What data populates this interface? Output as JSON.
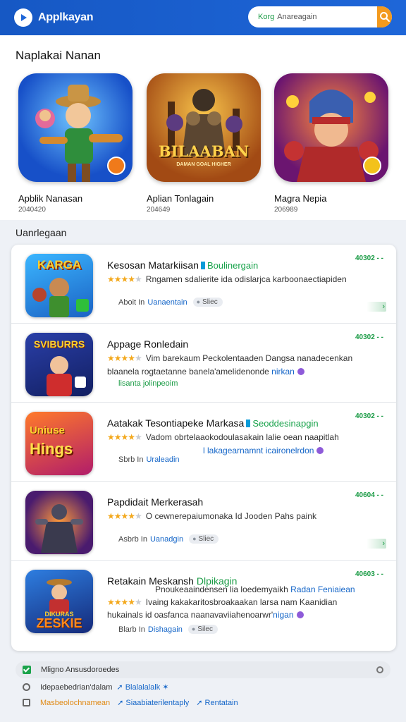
{
  "header": {
    "app_name": "Applkayan",
    "search_prefix": "Korg",
    "search_placeholder": "Anareagain",
    "accent_color": "#1e66d8",
    "search_button_color": "#f39a1e"
  },
  "featured": {
    "title": "Naplakai Nanan",
    "items": [
      {
        "name": "Apblik Nanasan",
        "sub": "2040420",
        "art_icon": "cowboy-hero-art"
      },
      {
        "name": "Aplian Tonlagain",
        "sub": "204649",
        "art_icon": "bilaaban-warrior-art",
        "art_text": "BILAABAN",
        "art_sub": "DAMAN GOAL HIGHER"
      },
      {
        "name": "Magra Nepia",
        "sub": "206989",
        "art_icon": "knight-helmet-art"
      }
    ]
  },
  "recommended": {
    "title": "Uanrlegaan",
    "items": [
      {
        "name": "Kesosan Matarkiisan",
        "tag": "Boulinergain",
        "size": "40302",
        "desc": "Rngamen sdalierite ida odislarjca karboonaectiapiden",
        "meta_prefix": "Aboit In",
        "meta_link": "Uanaentain",
        "pill": "Sliec",
        "icon_text": "KARGA",
        "rating": 4,
        "arrow": "›"
      },
      {
        "name": "Appage Ronledain",
        "size": "40302",
        "desc": "Vim barekaum Peckolentaaden Dangsa nanadecenkan",
        "desc2_prefix": "blaanela rogtaetanne",
        "desc2": "banela'amelidenonde",
        "desc2_link": "nirkan",
        "meta_line": "lisanta jolinpeoim",
        "icon_text": "SVIBURRS",
        "rating": 4
      },
      {
        "name": "Aatakak Tesontiapeke Markasa",
        "tag": "Seoddesinapgin",
        "size": "40302",
        "desc": "Vadom obrtelaaokodoulasakain lalie oean naapitlah",
        "desc2_link": "l lakagearnamnt icaironelrdon",
        "meta_prefix": "Sbrb In",
        "meta_link": "Uraleadin",
        "icon_text": "Hings",
        "icon_top": "Uniuse",
        "rating": 4
      },
      {
        "name": "Papdidait Merkerasah",
        "size": "40604",
        "desc": "O cewnerepaiumonaka Id Jooden Pahs paink",
        "meta_prefix": "Asbrb In",
        "meta_link": "Uanadgin",
        "pill": "Sliec",
        "icon_text": "",
        "rating": 4,
        "arrow": "›"
      },
      {
        "name": "Retakain Meskansh",
        "tag": "Dlpikagin",
        "size": "40603",
        "desc_top": "Pnoukeaaindensen lia loedemyaikh",
        "desc_top_link": "Radan Feniaiean",
        "desc": "Ivaing kakakaritosbroakaakan larsa nam Kaanidian",
        "desc2_prefix": "hukainals id oasfanca",
        "desc2": "naanavaviiahenoarwr'",
        "desc2_link": "nigan",
        "meta_prefix": "Blarb In",
        "meta_link": "Dishagain",
        "pill": "Silec",
        "icon_text": "ZESKIE",
        "icon_top": "DIKURAS",
        "rating": 4
      }
    ]
  },
  "footer": {
    "line1": "Mligno Ansusdoroedes",
    "line2": "Idepaebedrian'dalam",
    "line2_link": "Blalalalalk",
    "line3_orange": "Masbeolochnamean",
    "line3_link1": "Siaabiaterilentaply",
    "line3_link2": "Rentatain"
  }
}
